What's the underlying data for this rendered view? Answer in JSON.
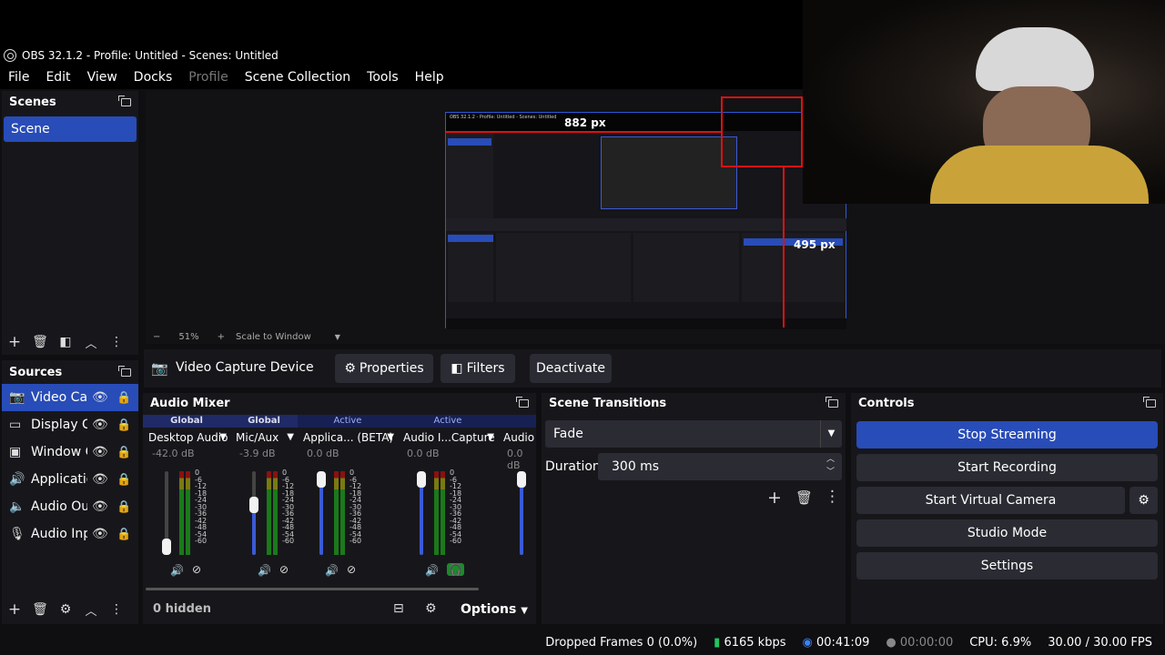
{
  "window": {
    "title": "OBS 32.1.2 - Profile: Untitled - Scenes: Untitled"
  },
  "menu": {
    "items": [
      "File",
      "Edit",
      "View",
      "Docks",
      "Profile",
      "Scene Collection",
      "Tools",
      "Help"
    ]
  },
  "scenes": {
    "title": "Scenes",
    "items": [
      "Scene"
    ]
  },
  "preview": {
    "zoom": "51%",
    "minus": "−",
    "plus": "+",
    "scale_mode": "Scale to Window",
    "nested": {
      "overlay_px_top": "882 px",
      "overlay_px_right": "495 px",
      "title": "OBS 32.1.2 - Profile: Untitled - Scenes: Untitled"
    }
  },
  "sources": {
    "title": "Sources",
    "items": [
      {
        "label": "Video Cap",
        "icon": "camera-icon"
      },
      {
        "label": "Display C",
        "icon": "monitor-icon"
      },
      {
        "label": "Window C",
        "icon": "window-icon"
      },
      {
        "label": "Applicatio",
        "icon": "app-audio-icon"
      },
      {
        "label": "Audio Out",
        "icon": "speaker-icon"
      },
      {
        "label": "Audio Inp",
        "icon": "mic-icon"
      }
    ]
  },
  "source_bar": {
    "name": "Video Capture Device",
    "properties": "Properties",
    "filters": "Filters",
    "deactivate": "Deactivate"
  },
  "mixer": {
    "title": "Audio Mixer",
    "hidden": "0 hidden",
    "options": "Options",
    "channels": [
      {
        "badge": "Global",
        "name": "Desktop Audio",
        "db": "-42.0 dB",
        "level": 0.15
      },
      {
        "badge": "Global",
        "name": "Mic/Aux",
        "db": "-3.9 dB",
        "level": 0.7
      },
      {
        "badge": "Active",
        "name": "Applica... (BETA)",
        "db": "0.0 dB",
        "level": 1.0
      },
      {
        "badge": "Active",
        "name": "Audio I...Capture",
        "db": "0.0 dB",
        "level": 1.0
      },
      {
        "badge": "",
        "name": "Audio ...",
        "db": "0.0 dB",
        "level": 1.0
      }
    ],
    "scale": [
      "0",
      "-6",
      "-12",
      "-18",
      "-24",
      "-30",
      "-36",
      "-42",
      "-48",
      "-54",
      "-60"
    ]
  },
  "transitions": {
    "title": "Scene Transitions",
    "selected": "Fade",
    "duration_label": "Duration",
    "duration_value": "300 ms"
  },
  "controls": {
    "title": "Controls",
    "stop_streaming": "Stop Streaming",
    "start_recording": "Start Recording",
    "start_virtual_camera": "Start Virtual Camera",
    "studio_mode": "Studio Mode",
    "settings": "Settings"
  },
  "statusbar": {
    "dropped": "Dropped Frames 0 (0.0%)",
    "bitrate": "6165 kbps",
    "stream_time": "00:41:09",
    "rec_time": "00:00:00",
    "cpu": "CPU: 6.9%",
    "fps": "30.00 / 30.00 FPS"
  },
  "colors": {
    "accent": "#284cb8",
    "panel": "#17171b",
    "background": "#0f0f12"
  }
}
